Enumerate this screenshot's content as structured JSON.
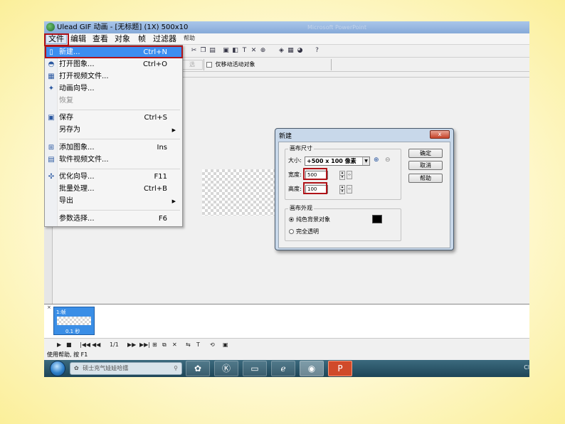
{
  "window": {
    "title": "Ulead GIF 动画 - [无标题] (1X) 500x10",
    "ghost_title": "Microsoft PowerPoint"
  },
  "menubar": {
    "items": [
      "文件",
      "编辑",
      "查看",
      "对象",
      "帧",
      "过滤器"
    ],
    "active": "文件",
    "help_label": "帮助"
  },
  "toolbar": {
    "move_only_active_label": "仅移动活动对象"
  },
  "file_menu": {
    "items": [
      {
        "label": "新建...",
        "shortcut": "Ctrl+N",
        "icon": "new-file-icon",
        "highlighted": true
      },
      {
        "label": "打开图象...",
        "shortcut": "Ctrl+O",
        "icon": "open-image-icon"
      },
      {
        "label": "打开视频文件...",
        "shortcut": "",
        "icon": "open-video-icon"
      },
      {
        "label": "动画向导...",
        "shortcut": "",
        "icon": "wizard-icon"
      },
      {
        "label": "恢复",
        "shortcut": "",
        "disabled": true
      },
      {
        "label": "保存",
        "shortcut": "Ctrl+S",
        "icon": "save-icon"
      },
      {
        "label": "另存为",
        "shortcut": "",
        "submenu": true
      },
      {
        "label": "添加图象...",
        "shortcut": "Ins",
        "icon": "add-image-icon"
      },
      {
        "label": "软件视频文件...",
        "shortcut": "",
        "icon": "video-file-icon"
      },
      {
        "label": "优化向导...",
        "shortcut": "F11",
        "icon": "optimize-icon"
      },
      {
        "label": "批量处理...",
        "shortcut": "Ctrl+B"
      },
      {
        "label": "导出",
        "shortcut": "",
        "submenu": true
      },
      {
        "label": "参数选择...",
        "shortcut": "F6"
      }
    ]
  },
  "dialog": {
    "title": "新建",
    "close_label": "x",
    "canvas_size_group": "画布尺寸",
    "size_label": "大小:",
    "size_value": "+500 x 100 像素",
    "width_label": "宽度:",
    "width_value": "500",
    "height_label": "高度:",
    "height_value": "100",
    "appearance_group": "画布外观",
    "option_solid": "纯色背景对象",
    "option_transparent": "完全透明",
    "selected_option": "solid",
    "swatch_color": "#000000",
    "ok_label": "确定",
    "cancel_label": "取消",
    "help_label": "帮助"
  },
  "frames": {
    "frame_label": "1:帧",
    "frame_delay": "0.1 秒"
  },
  "playback": {
    "frame_counter": "1/1"
  },
  "status_bar": {
    "text": "使用帮助, 按 F1"
  },
  "taskbar": {
    "search_text": "硕士充气娃娃哈擂",
    "clock_partial": "Cl"
  },
  "colors": {
    "highlight": "#3c8ef0",
    "annotation_red": "#b01318",
    "frame_selected": "#3a8ee6"
  }
}
